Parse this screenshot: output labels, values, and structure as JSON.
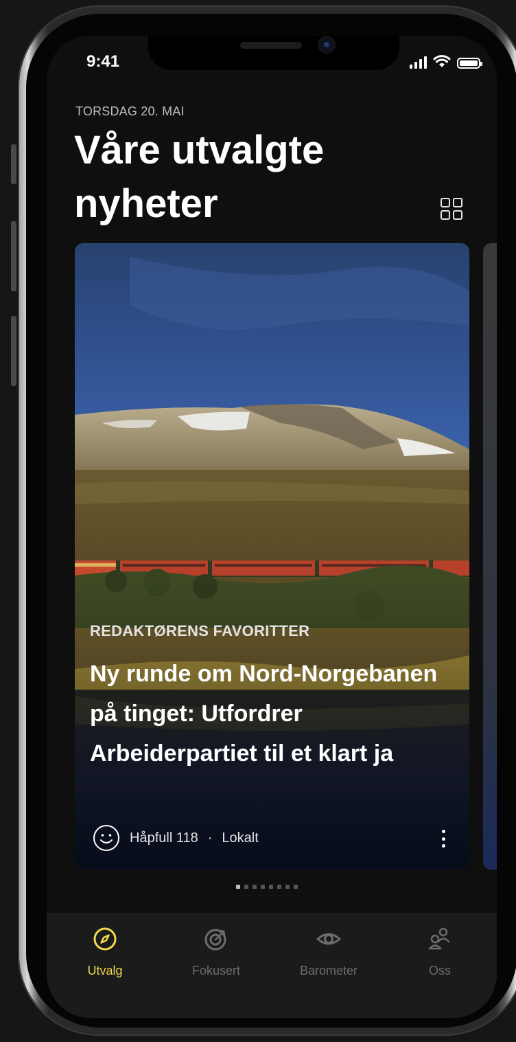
{
  "status_bar": {
    "time": "9:41"
  },
  "header": {
    "date": "TORSDAG 20. MAI",
    "title": "Våre utvalgte nyheter",
    "layout_icon": "grid-icon"
  },
  "card": {
    "kicker": "REDAKTØRENS FAVORITTER",
    "headline": "Ny runde om Nord-Norgebanen på tinget: Utfordrer Arbeiderpartiet til et klart ja",
    "mood_icon": "smiley-icon",
    "mood_label": "Håpfull 118",
    "separator": "·",
    "category": "Lokalt"
  },
  "pager": {
    "count": 8,
    "active": 0
  },
  "tabs": [
    {
      "label": "Utvalg",
      "icon": "compass-icon",
      "active": true
    },
    {
      "label": "Fokusert",
      "icon": "target-icon",
      "active": false
    },
    {
      "label": "Barometer",
      "icon": "eye-icon",
      "active": false
    },
    {
      "label": "Oss",
      "icon": "people-icon",
      "active": false
    }
  ],
  "colors": {
    "accent": "#f2d94e",
    "background": "#0f0f0f",
    "tabbar": "#1b1b1b"
  }
}
